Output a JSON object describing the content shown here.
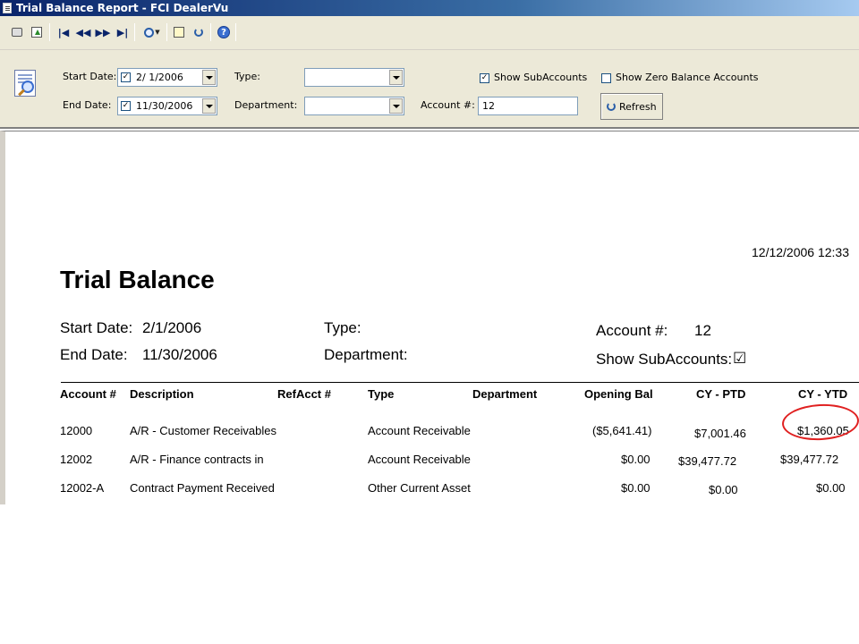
{
  "window": {
    "title": "Trial Balance Report - FCI DealerVu"
  },
  "toolbar": {
    "items": [
      "print-icon",
      "export-icon",
      "first-page-icon",
      "previous-page-icon",
      "next-page-icon",
      "last-page-icon",
      "zoom-icon",
      "find-icon",
      "refresh-icon",
      "help-icon"
    ],
    "first_glyph": "|◀",
    "prev_glyph": "◀◀",
    "next_glyph": "▶▶",
    "last_glyph": "▶|"
  },
  "filters": {
    "start_date_label": "Start Date:",
    "start_date_value": "2/ 1/2006",
    "start_date_checked": true,
    "end_date_label": "End Date:",
    "end_date_value": "11/30/2006",
    "end_date_checked": true,
    "type_label": "Type:",
    "type_value": "",
    "department_label": "Department:",
    "department_value": "",
    "account_label": "Account #:",
    "account_value": "12",
    "show_subaccounts_label": "Show SubAccounts",
    "show_subaccounts_checked": true,
    "show_zero_label": "Show Zero Balance Accounts",
    "show_zero_checked": false,
    "refresh_label": "Refresh"
  },
  "report": {
    "timestamp": "12/12/2006   12:33",
    "title": "Trial Balance",
    "start_date_label": "Start Date:",
    "start_date_value": "2/1/2006",
    "end_date_label": "End Date:",
    "end_date_value": "11/30/2006",
    "type_label": "Type:",
    "department_label": "Department:",
    "account_label": "Account #:",
    "account_value": "12",
    "show_subaccounts_label": "Show SubAccounts:",
    "show_subaccounts_mark": "☑",
    "columns": [
      "Account #",
      "Description",
      "RefAcct #",
      "Type",
      "Department",
      "Opening Bal",
      "CY - PTD",
      "CY - YTD"
    ],
    "rows": [
      [
        "12000",
        "A/R - Customer Receivables",
        "",
        "Account Receivable",
        "",
        "($5,641.41)",
        "$7,001.46",
        "$1,360.05"
      ],
      [
        "12002",
        "A/R - Finance contracts in",
        "",
        "Account Receivable",
        "",
        "$0.00",
        "$39,477.72",
        "$39,477.72"
      ],
      [
        "12002-A",
        "Contract Payment Received",
        "",
        "Other Current Asset",
        "",
        "$0.00",
        "$0.00",
        "$0.00"
      ]
    ]
  },
  "colors": {
    "titlebar": "#0a246a",
    "panel": "#ece9d8",
    "highlight_circle": "#e02020"
  }
}
